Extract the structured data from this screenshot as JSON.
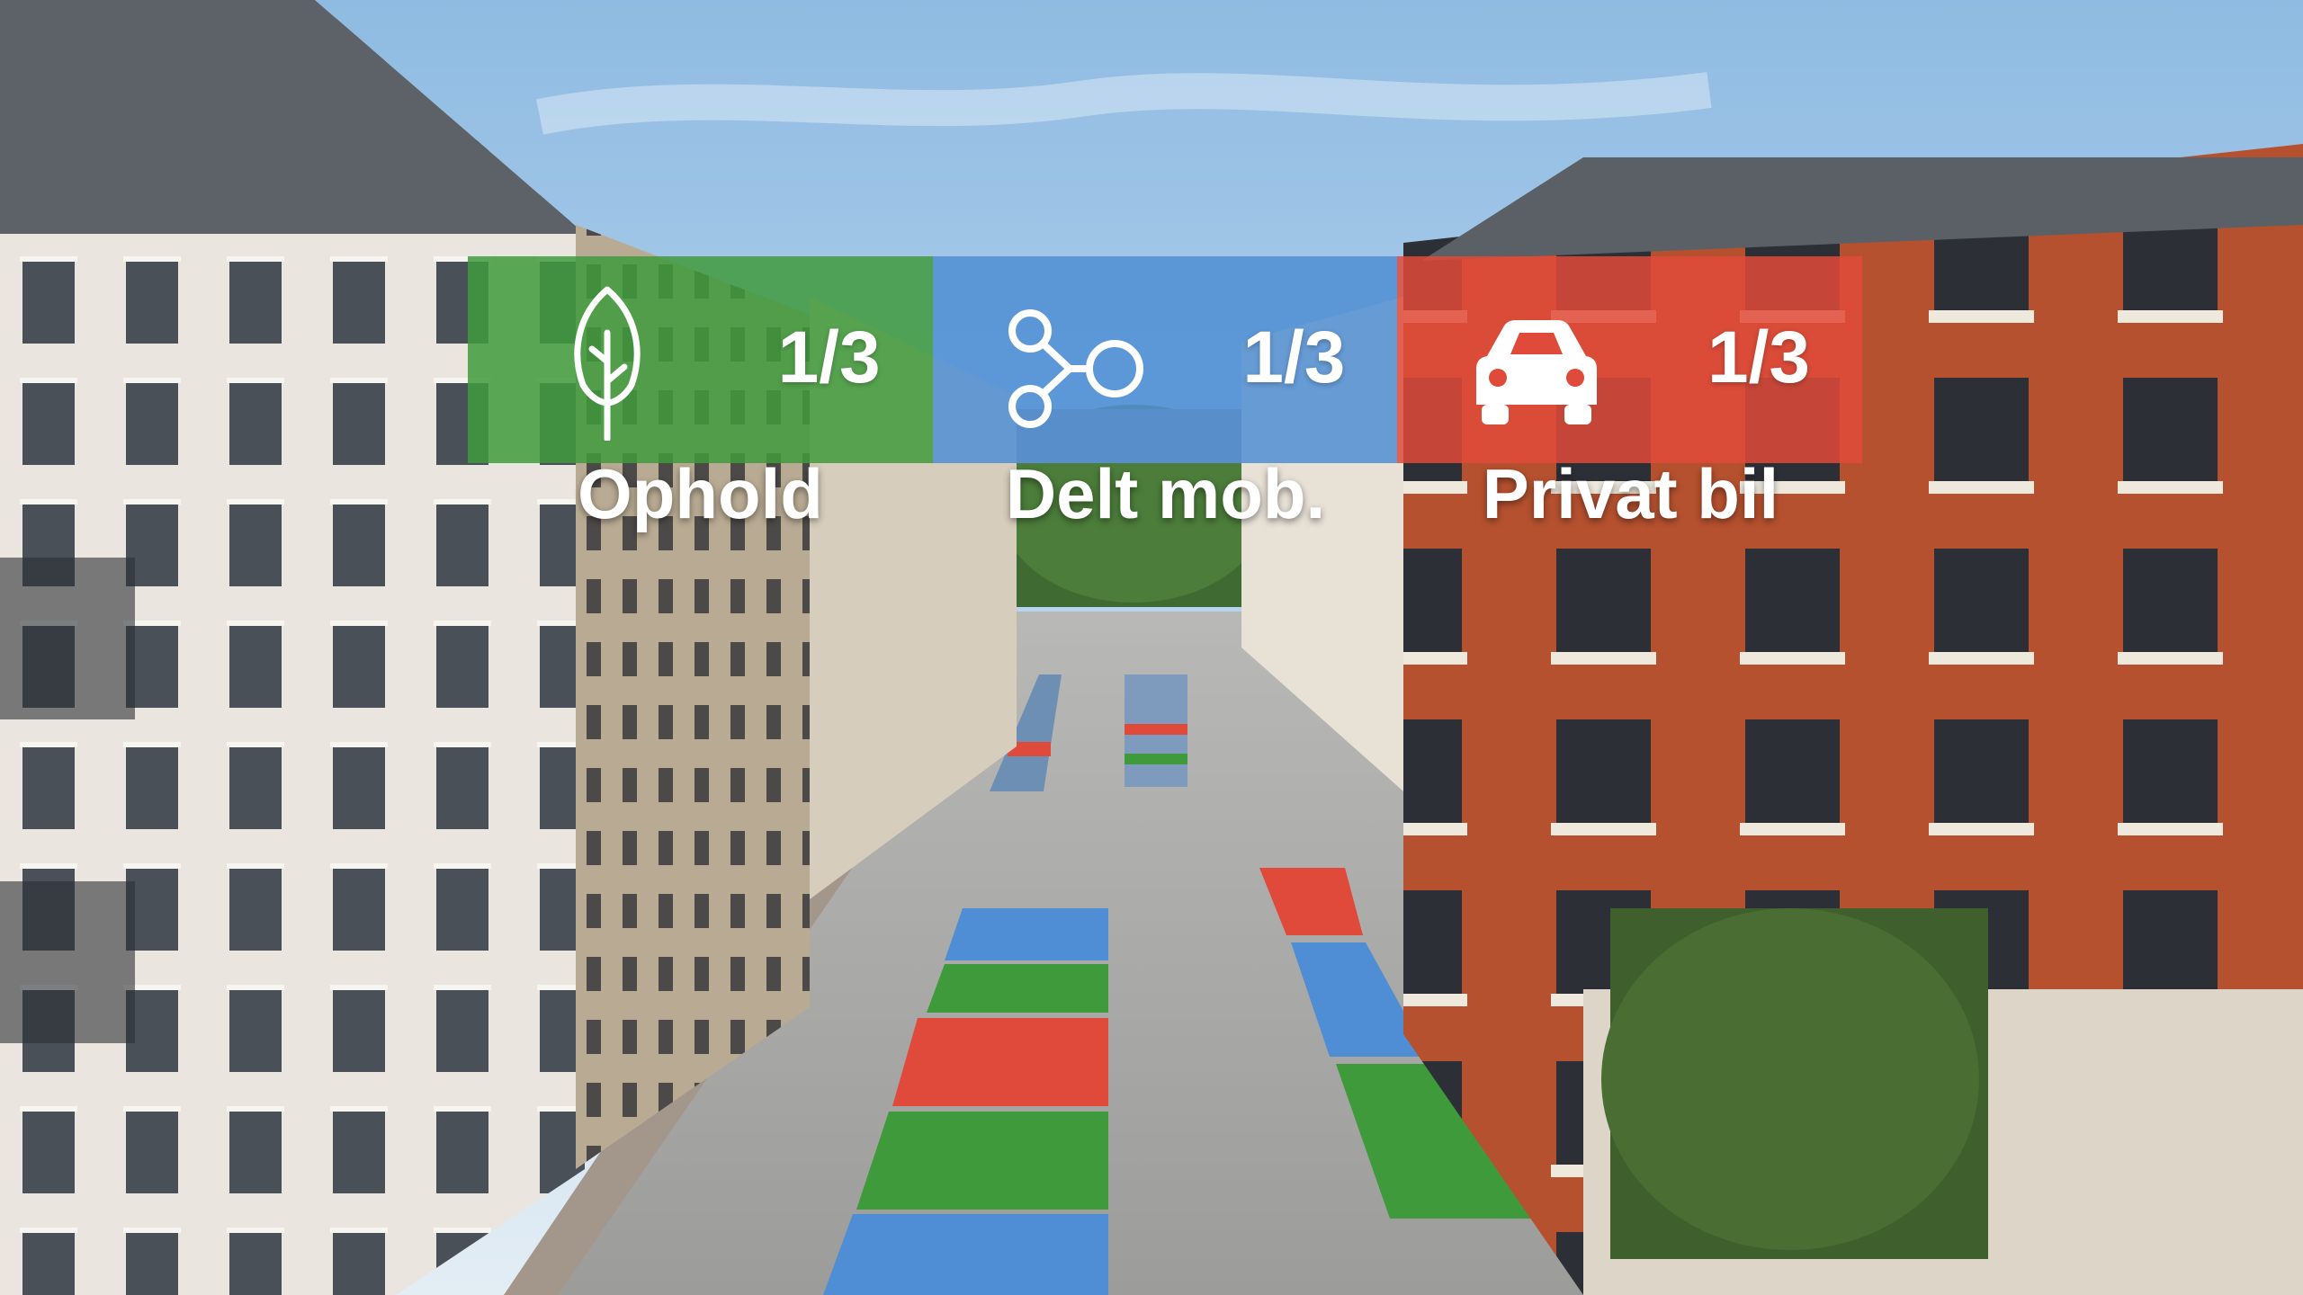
{
  "legend": [
    {
      "icon": "tree-icon",
      "fraction": "1/3",
      "label": "Ophold",
      "color": "#3f9a3c"
    },
    {
      "icon": "share-nodes-icon",
      "fraction": "1/3",
      "label": "Delt mob.",
      "color": "#4f8ed4"
    },
    {
      "icon": "car-icon",
      "fraction": "1/3",
      "label": "Privat bil",
      "color": "#e04a3a"
    }
  ],
  "colors": {
    "green": "#3f9a3c",
    "blue": "#4f8ed4",
    "red": "#e04a3a",
    "sky": "#a9cbe8"
  }
}
